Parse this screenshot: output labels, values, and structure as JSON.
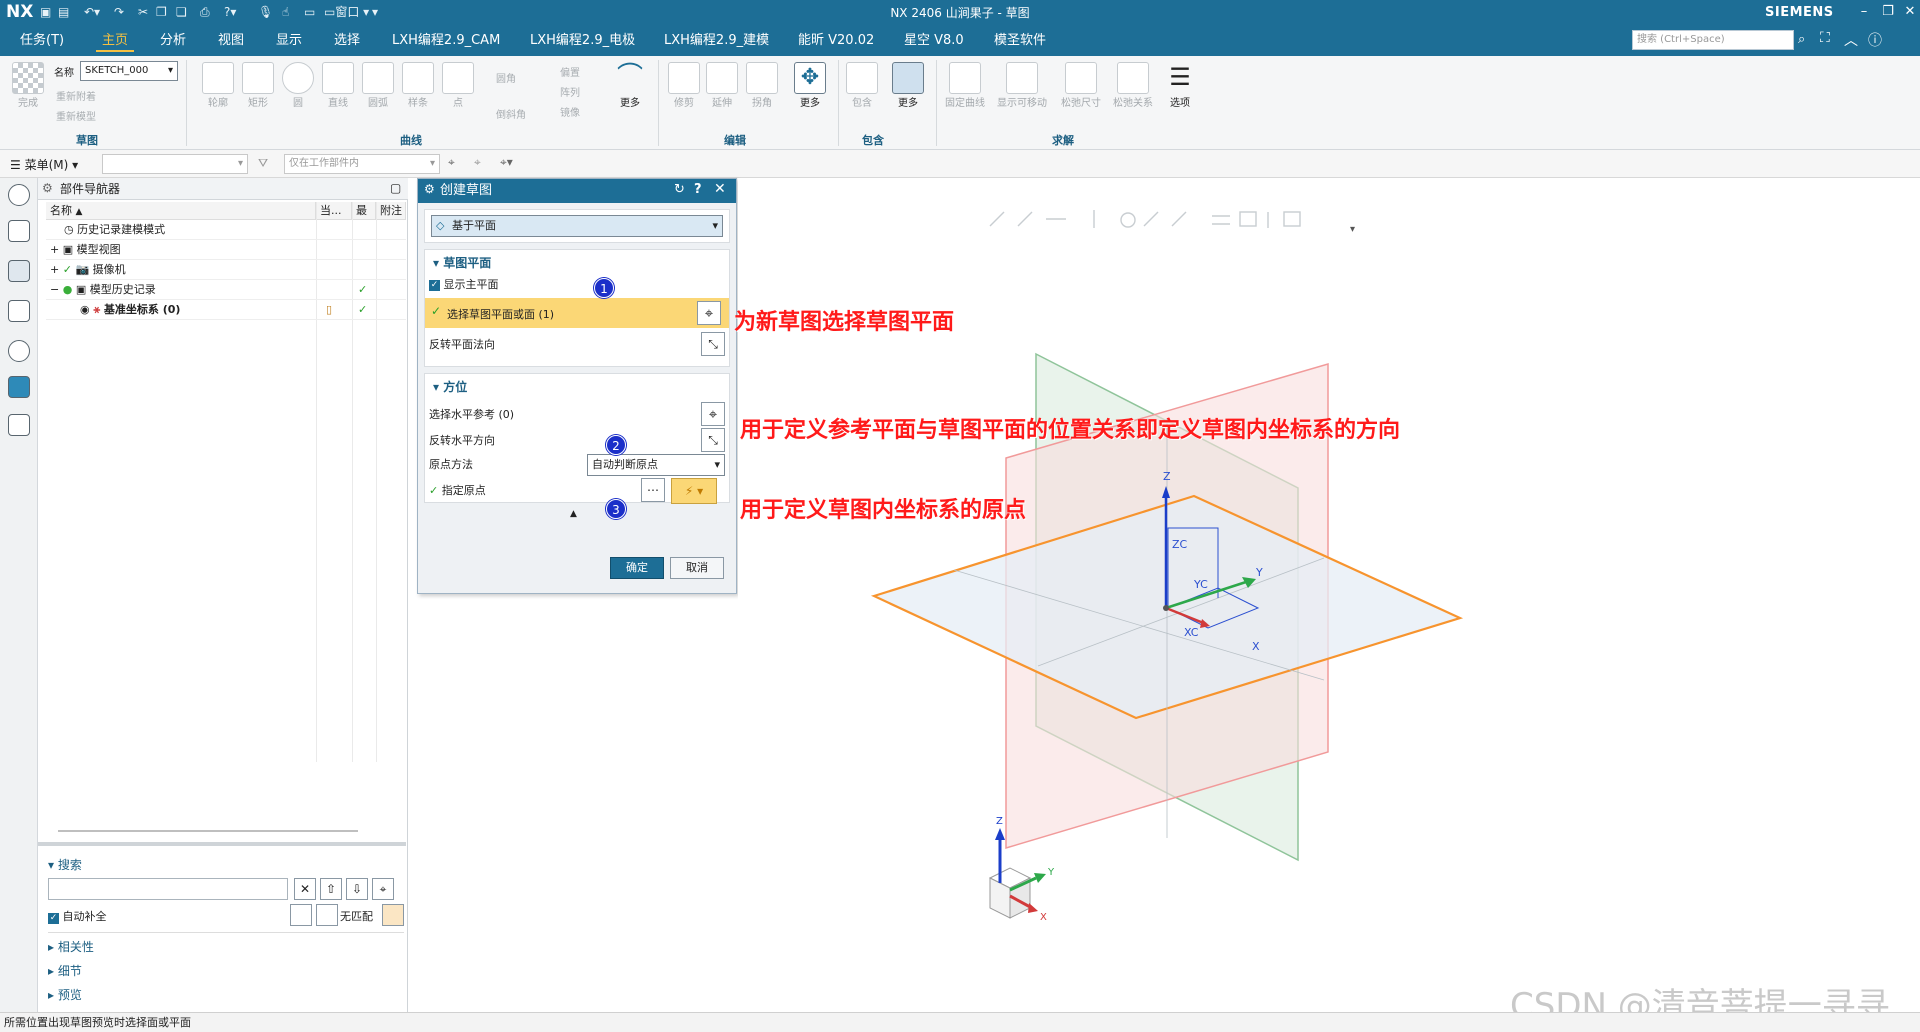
{
  "titlebar": {
    "logo": "NX",
    "window_menu": "窗口",
    "title": "NX 2406 山涧果子 - 草图",
    "brand": "SIEMENS"
  },
  "menu": {
    "tabs": [
      "任务(T)",
      "主页",
      "分析",
      "视图",
      "显示",
      "选择",
      "LXH编程2.9_CAM",
      "LXH编程2.9_电极",
      "LXH编程2.9_建模",
      "能昕 V20.02",
      "星空 V8.0",
      "模圣软件"
    ],
    "active_tab": "主页",
    "search_placeholder": "搜索 (Ctrl+Space)"
  },
  "ribbon": {
    "finish_label": "完成",
    "name_label": "名称",
    "sketch_name": "SKETCH_000",
    "reattach": "重新附着",
    "remodel": "重新模型",
    "group_sketch": "草图",
    "curve_buttons": [
      "轮廓",
      "矩形",
      "圆",
      "直线",
      "圆弧",
      "样条",
      "点"
    ],
    "fillet": "圆角",
    "chamfer": "倒斜角",
    "offset": "偏置",
    "pattern": "阵列",
    "mirror": "镜像",
    "more": "更多",
    "group_curve": "曲线",
    "edit_buttons": [
      "修剪",
      "延伸",
      "拐角"
    ],
    "group_edit": "编辑",
    "include": "包含",
    "group_include": "包含",
    "constraint_buttons": [
      "固定曲线",
      "显示可移动",
      "松弛尺寸",
      "松弛关系"
    ],
    "options": "选项",
    "group_solve": "求解"
  },
  "toolbar2": {
    "menu_label": "菜单(M)",
    "filter_combo": "仅在工作部件内"
  },
  "navigator": {
    "title": "部件导航器",
    "columns": [
      "名称",
      "当...",
      "最",
      "附注"
    ],
    "rows": [
      {
        "label": "历史记录建模模式",
        "check": ""
      },
      {
        "label": "模型视图",
        "check": ""
      },
      {
        "label": "摄像机",
        "check": ""
      },
      {
        "label": "模型历史记录",
        "check": "✓"
      },
      {
        "label": "基准坐标系 (0)",
        "check": "✓"
      }
    ],
    "search_header": "搜索",
    "autocomplete": "自动补全",
    "no_match": "无匹配",
    "sections": [
      "相关性",
      "细节",
      "预览"
    ]
  },
  "dialog": {
    "title": "创建草图",
    "type_value": "基于平面",
    "section1": "草图平面",
    "show_main_plane": "显示主平面",
    "select_plane": "选择草图平面或面 (1)",
    "reverse_plane_normal": "反转平面法向",
    "section2": "方位",
    "select_h_ref": "选择水平参考 (0)",
    "reverse_h_dir": "反转水平方向",
    "origin_method_label": "原点方法",
    "origin_method_value": "自动判断原点",
    "specify_origin": "指定原点",
    "ok": "确定",
    "cancel": "取消",
    "markers": [
      "1",
      "2",
      "3"
    ]
  },
  "annotations": {
    "a1": "为新草图选择草图平面",
    "a2": "用于定义参考平面与草图平面的位置关系即定义草图内坐标系的方向",
    "a3": "用于定义草图内坐标系的原点"
  },
  "viewport": {
    "axis_labels": [
      "Z",
      "ZC",
      "YC",
      "Y",
      "XC",
      "X"
    ],
    "triad_labels": [
      "Z",
      "Y",
      "X"
    ]
  },
  "status": {
    "text": "所需位置出现草图预览时选择面或平面"
  },
  "watermark": "CSDN @清音菩提一寻寻",
  "colors": {
    "title_blue": "#1d6e96",
    "accent_yellow": "#f4c042",
    "highlight_row": "#fbd776",
    "annotation_red": "#ff1a1a",
    "plane_orange": "#f7942e",
    "plane_green": "#8fc49a",
    "plane_red": "#f19a9a"
  }
}
